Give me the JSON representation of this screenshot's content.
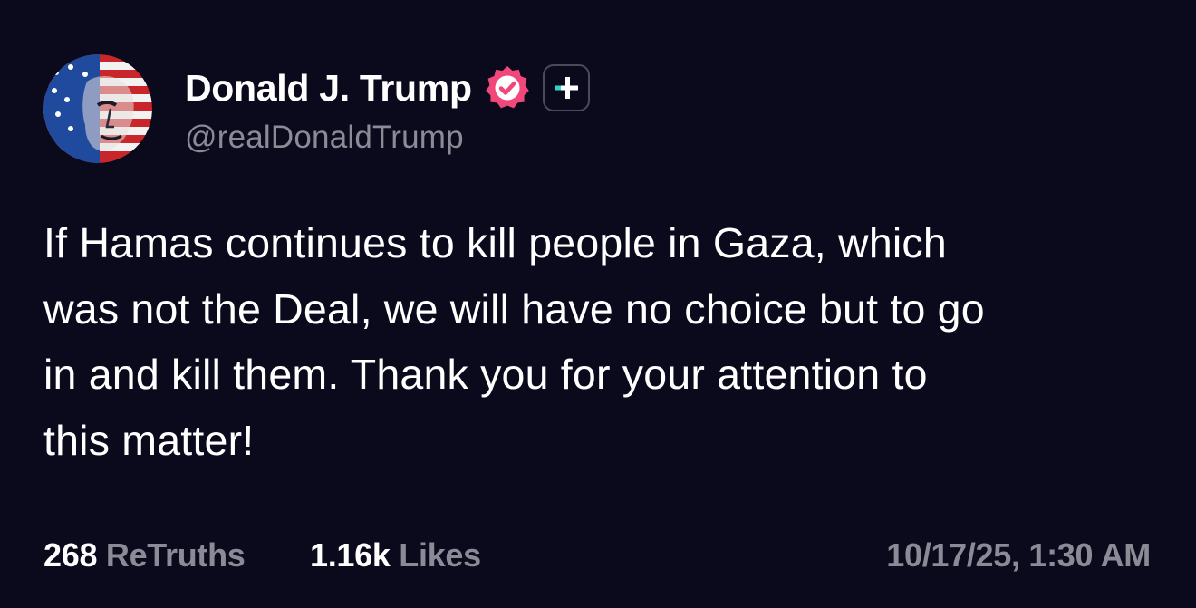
{
  "post": {
    "author": {
      "display_name": "Donald J. Trump",
      "handle": "@realDonaldTrump",
      "verified_icon": "verified-badge-icon",
      "plus_icon": "plus-badge-icon"
    },
    "text_lines": [
      "If Hamas continues to kill people in Gaza, which",
      "was not the Deal, we will have no choice but to go",
      "in and kill them. Thank you for your attention to",
      "this matter!"
    ],
    "stats": {
      "retruths_count": "268",
      "retruths_label": "ReTruths",
      "likes_count": "1.16k",
      "likes_label": "Likes"
    },
    "timestamp": "10/17/25, 1:30 AM"
  },
  "colors": {
    "background": "#0b0a1c",
    "text_primary": "#ffffff",
    "text_secondary": "#8b8b97",
    "verified_badge": "#f0487a",
    "plus_accent": "#2fd3c4"
  }
}
